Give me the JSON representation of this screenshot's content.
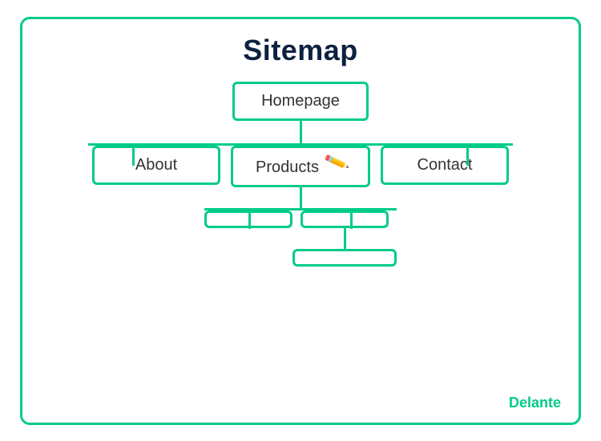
{
  "title": "Sitemap",
  "nodes": {
    "homepage": "Homepage",
    "about": "About",
    "products": "Products",
    "contact": "Contact"
  },
  "logo": {
    "brand": "Delante",
    "accent_letter": "D"
  }
}
